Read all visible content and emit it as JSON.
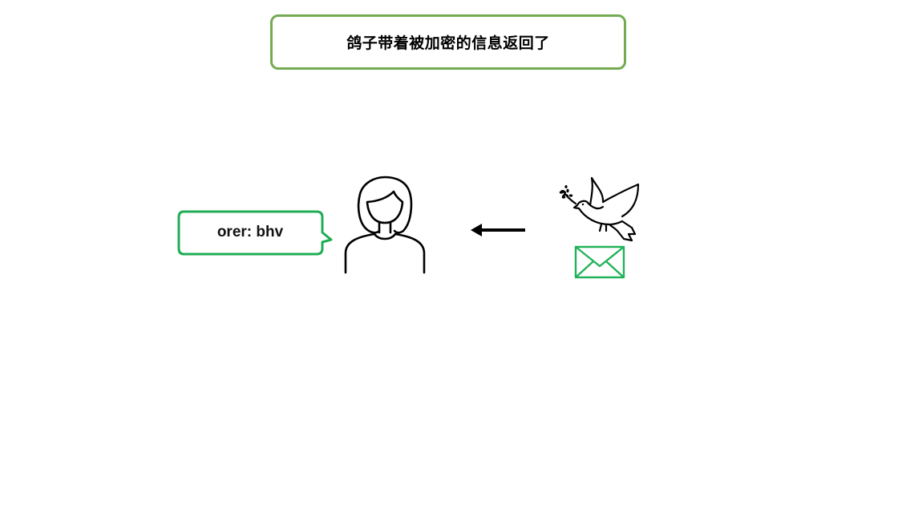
{
  "title": "鸽子带着被加密的信息返回了",
  "speech_bubble": {
    "text": "orer: bhv"
  },
  "icons": {
    "person": "woman-icon",
    "arrow": "arrow-left-icon",
    "bird": "dove-with-olive-branch-icon",
    "message": "envelope-icon"
  },
  "colors": {
    "title_border": "#74ab52",
    "bubble_border": "#1fad55",
    "envelope": "#22b35a",
    "line": "#000000"
  }
}
